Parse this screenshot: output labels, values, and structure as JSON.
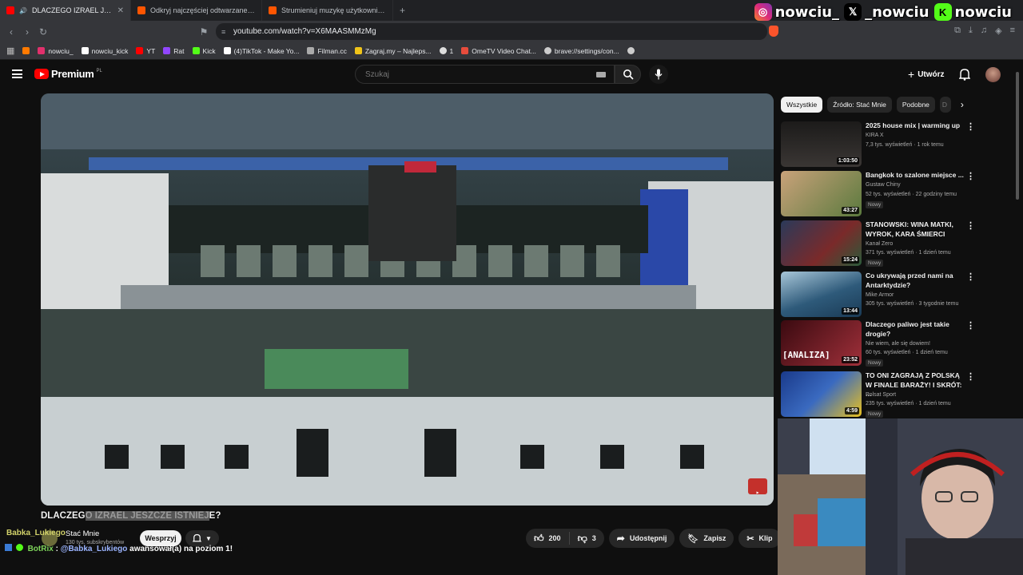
{
  "tabs": [
    {
      "label": "DLACZEGO IZRAEL JESZCZE I",
      "color": "#ff0000",
      "active": true
    },
    {
      "label": "Odkryj najczęściej odtwarzane utwor",
      "color": "#ff5500",
      "active": false
    },
    {
      "label": "Strumieniuj muzykę użytkownika SFW",
      "color": "#ff5500",
      "active": false
    }
  ],
  "brand": {
    "instagram": "nowciu_",
    "x": "_nowciu",
    "kick": "nowciu"
  },
  "address": {
    "url": "youtube.com/watch?v=X6MAASMMzMg"
  },
  "bookmarks": [
    {
      "label": "nowciu_",
      "color": "#e1306c"
    },
    {
      "label": "nowciu_kick",
      "color": "#ffffff"
    },
    {
      "label": "YT",
      "color": "#ff0000"
    },
    {
      "label": "Rat",
      "color": "#9146ff"
    },
    {
      "label": "Kick",
      "color": "#53fc18"
    },
    {
      "label": "(4)TikTok - Make Yo...",
      "color": "#ffffff"
    },
    {
      "label": "Filman.cc",
      "color": "#aaaaaa"
    },
    {
      "label": "Zagraj.my – Najleps...",
      "color": "#f0c419"
    },
    {
      "label": "1",
      "color": "#dddddd"
    },
    {
      "label": "OmeTV Video Chat...",
      "color": "#e74c3c"
    },
    {
      "label": "brave://settings/con...",
      "color": "#cccccc"
    }
  ],
  "youtube": {
    "logo_label": "Premium",
    "logo_region": "PL",
    "search_placeholder": "Szukaj",
    "create_label": "Utwórz"
  },
  "video": {
    "title_start": "DLACZEG",
    "title_highlight": "O IZRAEL JESZCZE ISTNIEJ",
    "title_end": "E?",
    "channel": "Stać Mnie",
    "subscribers": "130 tys. subskrybentów",
    "support_label": "Wesprzyj",
    "likes": "200",
    "dislikes": "3",
    "share_label": "Udostępnij",
    "save_label": "Zapisz",
    "clip_label": "Klip"
  },
  "chat": {
    "user1": "Babka_Lukiego",
    "bot_name": "BotRix",
    "bot_sep": ":",
    "mention": "@Babka_Lukiego",
    "message": "awansował(a) na poziom 1!"
  },
  "chips": [
    "Wszystkie",
    "Źródło: Stać Mnie",
    "Podobne",
    "D"
  ],
  "recommendations": [
    {
      "title": "2025 house mix | warming up",
      "channel": "KIRA X",
      "meta": "7,3 tys. wyświetleń · 1 rok temu",
      "duration": "1:03:50",
      "badge": "",
      "thumb": "#2f2c2b"
    },
    {
      "title": "Bangkok to szalone miejsce ...",
      "channel": "Gustaw Chiny",
      "meta": "52 tys. wyświetleń · 22 godziny temu",
      "duration": "43:27",
      "badge": "Nowy",
      "thumb": "#8a6a4a"
    },
    {
      "title": "STANOWSKI: WINA MATKI, WYROK, KARA ŚMIERCI",
      "channel": "Kanał Zero",
      "meta": "371 tys. wyświetleń · 1 dzień temu",
      "duration": "15:24",
      "badge": "Nowy",
      "thumb": "#3a5a6a"
    },
    {
      "title": "Co ukrywają przed nami na Antarktydzie?",
      "channel": "Mike Armor",
      "meta": "305 tys. wyświetleń · 3 tygodnie temu",
      "duration": "13:44",
      "badge": "",
      "thumb": "#5a7a8a"
    },
    {
      "title": "Dlaczego paliwo jest takie drogie?",
      "channel": "Nie wiem, ale się dowiem!",
      "meta": "60 tys. wyświetleń · 1 dzień temu",
      "duration": "23:52",
      "badge": "Nowy",
      "thumb": "#5a1a1e",
      "overlay": "[ANALIZA]"
    },
    {
      "title": "TO ONI ZAGRAJĄ Z POLSKĄ W FINALE BARAŻY! I SKRÓT: ...",
      "channel": "Polsat Sport",
      "meta": "235 tys. wyświetleń · 1 dzień temu",
      "duration": "4:59",
      "badge": "Nowy",
      "thumb": "#1f3f7a"
    }
  ]
}
